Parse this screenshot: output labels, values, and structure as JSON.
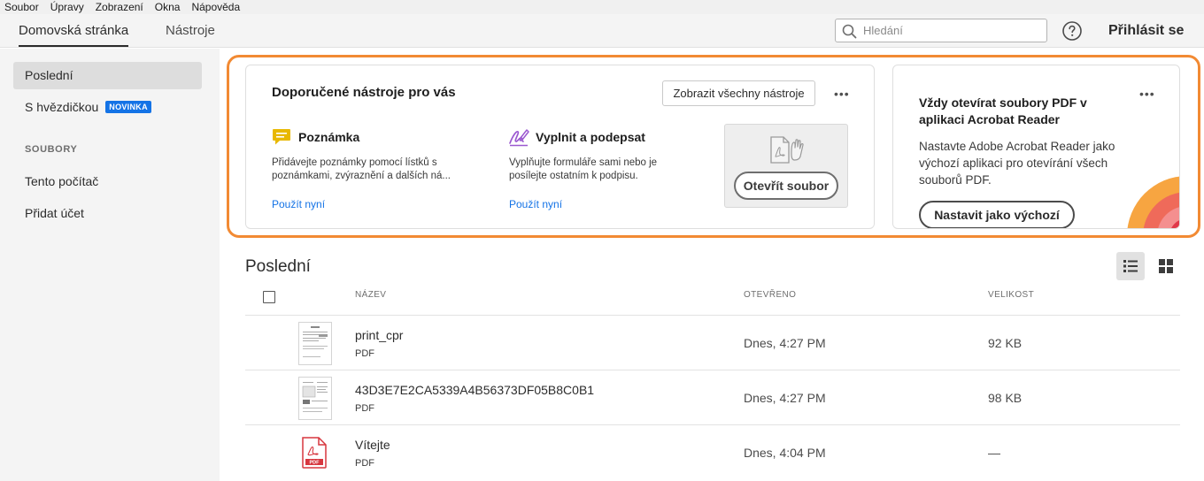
{
  "menubar": [
    "Soubor",
    "Úpravy",
    "Zobrazení",
    "Okna",
    "Nápověda"
  ],
  "topnav": {
    "tabs": [
      "Domovská stránka",
      "Nástroje"
    ],
    "search_placeholder": "Hledání",
    "login_label": "Přihlásit se"
  },
  "sidebar": {
    "recent": "Poslední",
    "starred": "S hvězdičkou",
    "starred_badge": "NOVINKA",
    "files_header": "SOUBORY",
    "this_computer": "Tento počítač",
    "add_account": "Přidat účet"
  },
  "tools_card": {
    "title": "Doporučené nástroje pro vás",
    "show_all_label": "Zobrazit všechny nástroje",
    "tools": [
      {
        "title": "Poznámka",
        "desc_line1": "Přidávejte poznámky pomocí lístků s",
        "desc_line2": "poznámkami, zvýraznění a dalších ná...",
        "link": "Použít nyní",
        "icon_color": "#e8b800"
      },
      {
        "title": "Vyplnit a podepsat",
        "desc_line1": "Vyplňujte formuláře sami nebo je",
        "desc_line2": "posílejte ostatním k podpisu.",
        "link": "Použít nyní",
        "icon_color": "#9b59d0"
      }
    ],
    "open_file_label": "Otevřít soubor"
  },
  "default_card": {
    "title": "Vždy otevírat soubory PDF v aplikaci Acrobat Reader",
    "desc": "Nastavte Adobe Acrobat Reader jako výchozí aplikaci pro otevírání všech souborů PDF.",
    "button_label": "Nastavit jako výchozí"
  },
  "recent": {
    "title": "Poslední",
    "columns": {
      "name": "NÁZEV",
      "opened": "OTEVŘENO",
      "size": "VELIKOST"
    },
    "files": [
      {
        "name": "print_cpr",
        "type": "PDF",
        "opened": "Dnes, 4:27 PM",
        "size": "92 KB"
      },
      {
        "name": "43D3E7E2CA5339A4B56373DF05B8C0B1",
        "type": "PDF",
        "opened": "Dnes, 4:27 PM",
        "size": "98 KB"
      },
      {
        "name": "Vítejte",
        "type": "PDF",
        "opened": "Dnes, 4:04 PM",
        "size": "—"
      }
    ]
  },
  "colors": {
    "accent": "#1473e6",
    "highlight": "#f28a33",
    "pdf_red": "#d7373f"
  }
}
